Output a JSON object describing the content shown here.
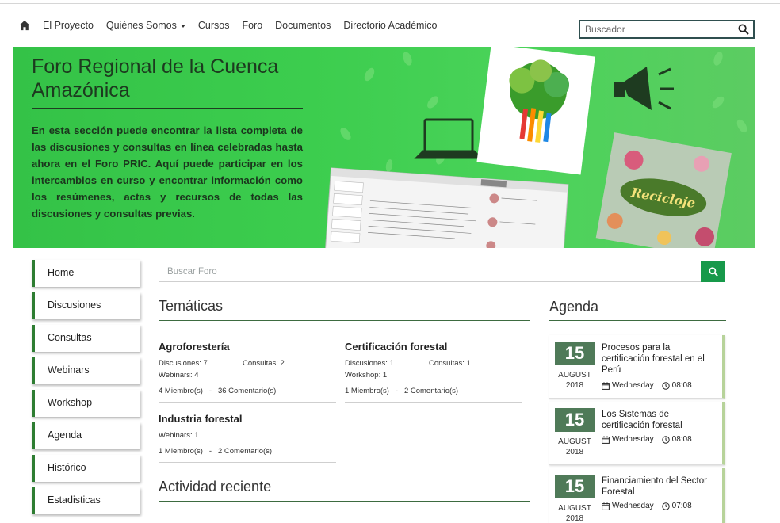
{
  "nav": {
    "items": [
      {
        "label": "El Proyecto"
      },
      {
        "label": "Quiénes Somos",
        "dropdown": true
      },
      {
        "label": "Cursos"
      },
      {
        "label": "Foro"
      },
      {
        "label": "Documentos"
      },
      {
        "label": "Directorio Académico"
      }
    ],
    "search_placeholder": "Buscador"
  },
  "banner": {
    "title": "Foro Regional de la Cuenca Amazónica",
    "text": "En esta sección puede encontrar la lista completa de las discusiones y consultas en línea celebradas hasta ahora en el Foro PRIC. Aquí puede participar en los intercambios en curso y encontrar información como los resúmenes, actas y recursos de todas las discusiones y consultas previas.",
    "art_text": "Recicloje"
  },
  "sidebar": {
    "items": [
      {
        "label": "Home"
      },
      {
        "label": "Discusiones"
      },
      {
        "label": "Consultas"
      },
      {
        "label": "Webinars"
      },
      {
        "label": "Workshop"
      },
      {
        "label": "Agenda"
      },
      {
        "label": "Histórico"
      },
      {
        "label": "Estadisticas"
      }
    ]
  },
  "forum_search": {
    "placeholder": "Buscar Foro"
  },
  "tematicas": {
    "title": "Temáticas",
    "topics": [
      {
        "name": "Agroforestería",
        "r1l": "Discusiones: 7",
        "r1r": "Consultas: 2",
        "r2l": "Webinars: 4",
        "meta": "4 Miembro(s)   -   36 Comentario(s)"
      },
      {
        "name": "Certificación forestal",
        "r1l": "Discusiones: 1",
        "r1r": "Consultas: 1",
        "r2l": "Workshop: 1",
        "meta": "1 Miembro(s)   -   2 Comentario(s)"
      },
      {
        "name": "Industria forestal",
        "r1l": "Webinars: 1",
        "meta": "1 Miembro(s)   -   2 Comentario(s)"
      }
    ]
  },
  "actividad": {
    "title": "Actividad reciente"
  },
  "agenda": {
    "title": "Agenda",
    "events": [
      {
        "day": "15",
        "month": "AUGUST",
        "year": "2018",
        "title": "Procesos para la certificación forestal en el Perú",
        "weekday": "Wednesday",
        "time": "08:08"
      },
      {
        "day": "15",
        "month": "AUGUST",
        "year": "2018",
        "title": "Los Sistemas de certificación forestal",
        "weekday": "Wednesday",
        "time": "08:08"
      },
      {
        "day": "15",
        "month": "AUGUST",
        "year": "2018",
        "title": "Financiamiento del Sector Forestal",
        "weekday": "Wednesday",
        "time": "07:08"
      }
    ]
  },
  "colors": {
    "banner_green": "#3ccd4e",
    "accent_green": "#2e7d32",
    "button_green": "#17994a",
    "date_badge": "#4f7a58"
  }
}
